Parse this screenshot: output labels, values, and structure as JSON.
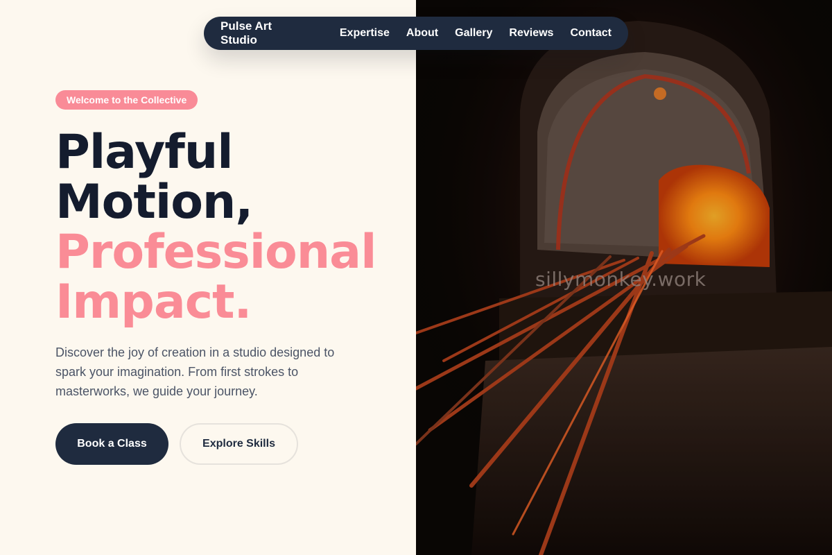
{
  "nav": {
    "brand": "Pulse Art Studio",
    "links": [
      "Expertise",
      "About",
      "Gallery",
      "Reviews",
      "Contact"
    ]
  },
  "hero": {
    "badge": "Welcome to the Collective",
    "headline_dark_1": "Playful",
    "headline_dark_2": "Motion,",
    "headline_pink_1": "Professional",
    "headline_pink_2": "Impact.",
    "description": "Discover the joy of creation in a studio designed to spark your imagination. From first strokes to masterworks, we guide your journey.",
    "primary_button": "Book a Class",
    "secondary_button": "Explore Skills"
  },
  "image": {
    "watermark": "sillymonkey.work"
  },
  "colors": {
    "navy": "#1f2b3f",
    "pink": "#fa8c96",
    "cream": "#fdf8ef",
    "heading": "#141c2e"
  }
}
